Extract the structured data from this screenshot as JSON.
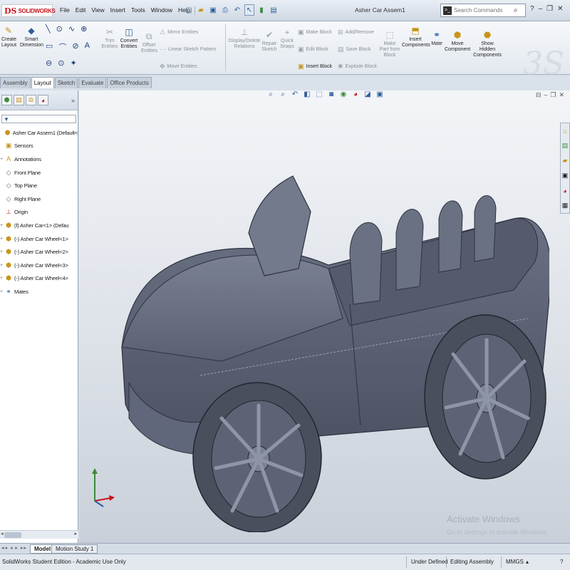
{
  "app": {
    "logo_mark": "DS",
    "logo_text": "SOLIDWORKS"
  },
  "menu": [
    "File",
    "Edit",
    "View",
    "Insert",
    "Tools",
    "Window",
    "Help"
  ],
  "quick_access_icons": [
    "new-icon",
    "open-icon",
    "save-icon",
    "print-icon",
    "undo-icon",
    "select-icon",
    "rebuild-icon",
    "options-icon"
  ],
  "document_title": "Asher Car Assem1",
  "search": {
    "placeholder": "Search Commands"
  },
  "command_manager": {
    "create_layout": "Create\nLayout",
    "smart_dimension": "Smart\nDimension",
    "trim_entities": "Trim\nEntities",
    "convert_entities": "Convert\nEntities",
    "offset_entities": "Offset\nEntities",
    "mirror_entities": "Mirror Entities",
    "linear_sketch_pattern": "Linear Sketch Pattern",
    "move_entities": "Move Entities",
    "display_delete_relations": "Display/Delete\nRelations",
    "repair_sketch": "Repair\nSketch",
    "quick_snaps": "Quick\nSnaps",
    "make_block": "Make Block",
    "edit_block": "Edit Block",
    "insert_block": "Insert Block",
    "add_remove": "Add/Remove",
    "save_block": "Save Block",
    "explode_block": "Explode Block",
    "make_part_from_block": "Make\nPart from\nBlock",
    "insert_components": "Insert\nComponents",
    "mate": "Mate",
    "move_component": "Move\nComponent",
    "show_hidden_components": "Show\nHidden\nComponents"
  },
  "tabs": [
    {
      "label": "Assembly",
      "active": false
    },
    {
      "label": "Layout",
      "active": true
    },
    {
      "label": "Sketch",
      "active": false
    },
    {
      "label": "Evaluate",
      "active": false
    },
    {
      "label": "Office Products",
      "active": false
    }
  ],
  "feature_tree": [
    {
      "label": "Asher Car Assem1  (Default<",
      "icon": "assembly-icon",
      "expander": ""
    },
    {
      "label": "Sensors",
      "icon": "sensors-folder-icon",
      "expander": ""
    },
    {
      "label": "Annotations",
      "icon": "annotations-icon",
      "expander": "+"
    },
    {
      "label": "Front Plane",
      "icon": "plane-icon",
      "expander": ""
    },
    {
      "label": "Top Plane",
      "icon": "plane-icon",
      "expander": ""
    },
    {
      "label": "Right Plane",
      "icon": "plane-icon",
      "expander": ""
    },
    {
      "label": "Origin",
      "icon": "origin-icon",
      "expander": ""
    },
    {
      "label": "(f) Asher Car<1> (Defau",
      "icon": "part-icon",
      "expander": "+"
    },
    {
      "label": "(-) Asher Car Wheel<1>",
      "icon": "part-icon",
      "expander": "+"
    },
    {
      "label": "(-) Asher Car Wheel<2>",
      "icon": "part-icon",
      "expander": "+"
    },
    {
      "label": "(-) Asher Car Wheel<3>",
      "icon": "part-icon",
      "expander": "+"
    },
    {
      "label": "(-) Asher Car Wheel<4>",
      "icon": "part-icon",
      "expander": "+"
    },
    {
      "label": "Mates",
      "icon": "mates-icon",
      "expander": "+"
    }
  ],
  "watermark": {
    "line1": "Activate Windows",
    "line2": "Go to Settings to activate Windows."
  },
  "bottom_tabs": [
    {
      "label": "Model",
      "active": true
    },
    {
      "label": "Motion Study 1",
      "active": false
    }
  ],
  "status": {
    "edition": "SolidWorks Student Edition - Academic Use Only",
    "definition": "Under Defined",
    "mode": "Editing Assembly",
    "units": "MMGS"
  },
  "colors": {
    "brand_red": "#c8161d",
    "accent_blue": "#2f5d9b",
    "model_gray": "#6f7788"
  }
}
